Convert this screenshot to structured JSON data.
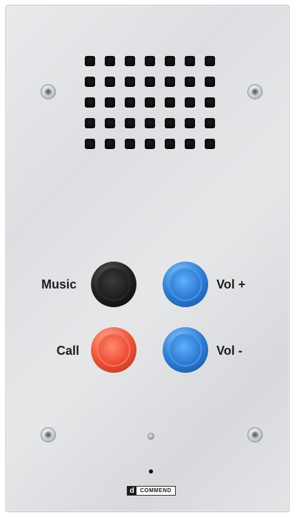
{
  "panel": {
    "brand": "COMMEND",
    "brand_mark": "d"
  },
  "buttons": {
    "music_label": "Music",
    "vol_up_label": "Vol +",
    "call_label": "Call",
    "vol_down_label": "Vol -"
  },
  "colors": {
    "music_button": "#1b1b1b",
    "call_button": "#ec4b30",
    "volume_button": "#2a78d0",
    "panel": "#e0e2e4"
  },
  "icons": {
    "screws": "screw-icon",
    "speaker": "speaker-grille",
    "led": "led-indicator",
    "microphone": "microphone-hole"
  }
}
